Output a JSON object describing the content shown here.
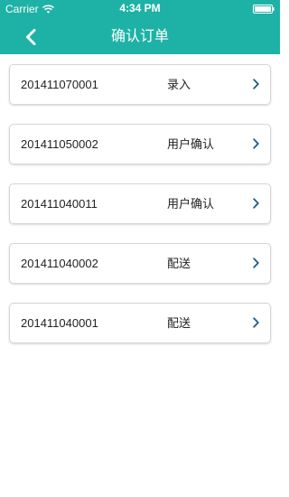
{
  "status_bar": {
    "carrier": "Carrier",
    "time": "4:34 PM"
  },
  "header": {
    "title": "确认订单",
    "back_icon": "chevron-left-icon",
    "background_color": "#1eb2a6"
  },
  "orders": [
    {
      "id": "201411070001",
      "status": "录入"
    },
    {
      "id": "201411050002",
      "status": "用户确认"
    },
    {
      "id": "201411040011",
      "status": "用户确认"
    },
    {
      "id": "201411040002",
      "status": "配送"
    },
    {
      "id": "201411040001",
      "status": "配送"
    }
  ]
}
